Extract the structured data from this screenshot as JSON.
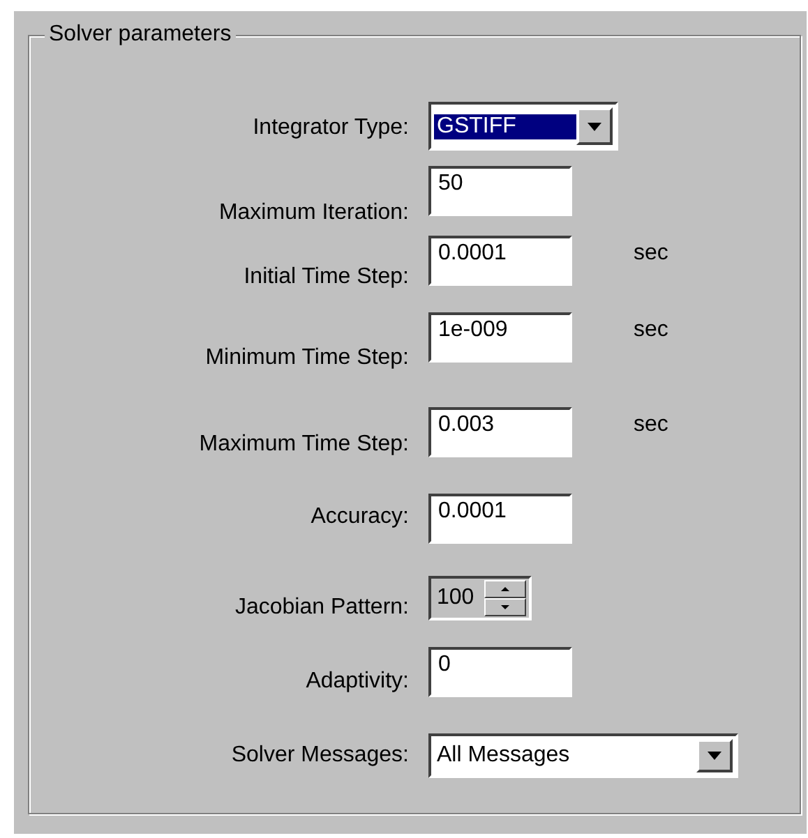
{
  "group": {
    "title": "Solver parameters"
  },
  "rows": [
    {
      "kind": "dropdown",
      "label": "Integrator Type:",
      "value": "GSTIFF",
      "focused": true,
      "disabled": false
    },
    {
      "kind": "text",
      "label": "Maximum Iteration:",
      "value": "50",
      "focused": false,
      "disabled": false
    },
    {
      "kind": "text",
      "label": "Initial Time Step:",
      "value": "0.0001",
      "unit": "sec",
      "focused": false,
      "disabled": false
    },
    {
      "kind": "text",
      "label": "Minimum Time Step:",
      "value": "1e-009",
      "unit": "sec",
      "focused": false,
      "disabled": false
    },
    {
      "kind": "text",
      "label": "Maximum Time Step:",
      "value": "0.003",
      "unit": "sec",
      "focused": false,
      "disabled": false
    },
    {
      "kind": "text",
      "label": "Accuracy:",
      "value": "0.0001",
      "focused": false,
      "disabled": false
    },
    {
      "kind": "spin",
      "label": "Jacobian Pattern:",
      "value": "100",
      "focused": false,
      "disabled": true
    },
    {
      "kind": "text",
      "label": "Adaptivity:",
      "value": "0",
      "focused": false,
      "disabled": false
    },
    {
      "kind": "wide-dropdown",
      "label": "Solver Messages:",
      "value": "All Messages",
      "focused": false,
      "disabled": false
    }
  ]
}
